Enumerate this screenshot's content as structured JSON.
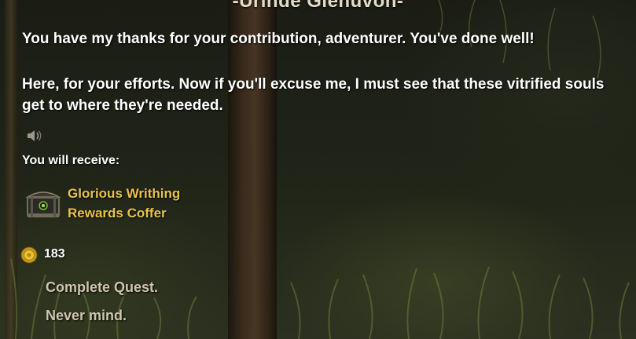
{
  "npc_name": "-Urinde Glenuvon-",
  "dialogue": {
    "paragraph_1": "You have my thanks for your contribution, adventurer. You've done well!",
    "paragraph_2": "Here, for your efforts. Now if you'll excuse me, I must see that these vitrified souls get to where they're needed."
  },
  "voice_icon": "speaker-icon",
  "rewards": {
    "label": "You will receive:",
    "item": {
      "name_line_1": "Glorious Writhing",
      "name_line_2": "Rewards Coffer",
      "icon": "coffer-icon",
      "color": "#e8c34a"
    },
    "gold": {
      "amount": "183",
      "icon": "gold-coin-icon"
    }
  },
  "options": [
    {
      "label": "Complete Quest."
    },
    {
      "label": "Never mind."
    }
  ]
}
